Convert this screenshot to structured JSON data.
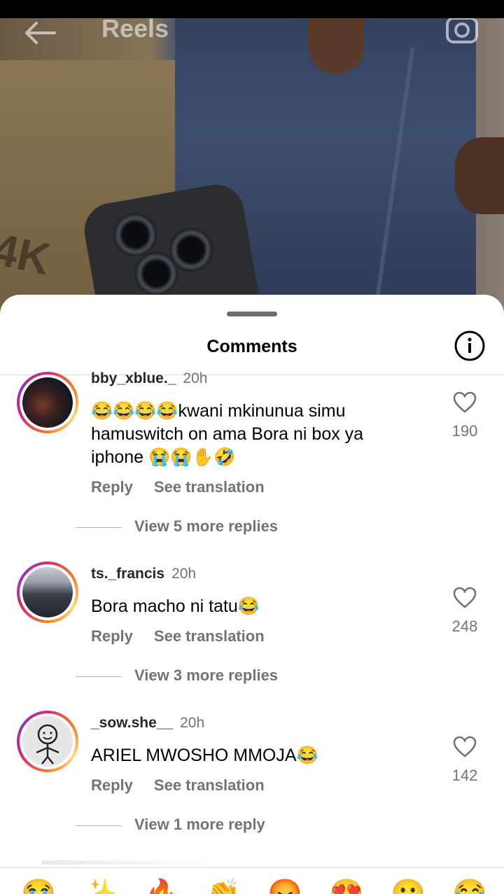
{
  "header": {
    "title": "Reels"
  },
  "video": {
    "box_label": "4K"
  },
  "sheet": {
    "title": "Comments"
  },
  "comments": [
    {
      "username": "bby_xblue._",
      "time": "20h",
      "text": "😂😂😂😂kwani mkinunua simu hamuswitch on ama Bora ni box ya iphone 😭😭✋🤣",
      "likes": "190",
      "reply_label": "Reply",
      "translate_label": "See translation",
      "more_replies": "View 5 more replies"
    },
    {
      "username": "ts._francis",
      "time": "20h",
      "text": "Bora macho ni tatu😂",
      "likes": "248",
      "reply_label": "Reply",
      "translate_label": "See translation",
      "more_replies": "View 3 more replies"
    },
    {
      "username": "_sow.she__",
      "time": "20h",
      "text": "ARIEL MWOSHO MMOJA😂",
      "likes": "142",
      "reply_label": "Reply",
      "translate_label": "See translation",
      "more_replies": "View 1 more reply"
    }
  ],
  "emoji_bar": [
    "😭",
    "✨",
    "🔥",
    "👏",
    "😡",
    "😍",
    "😮",
    "😂"
  ],
  "colors": {
    "accent_ring_start": "#d62976",
    "accent_ring_mid": "#fa7e1e",
    "secondary_text": "#737373"
  }
}
